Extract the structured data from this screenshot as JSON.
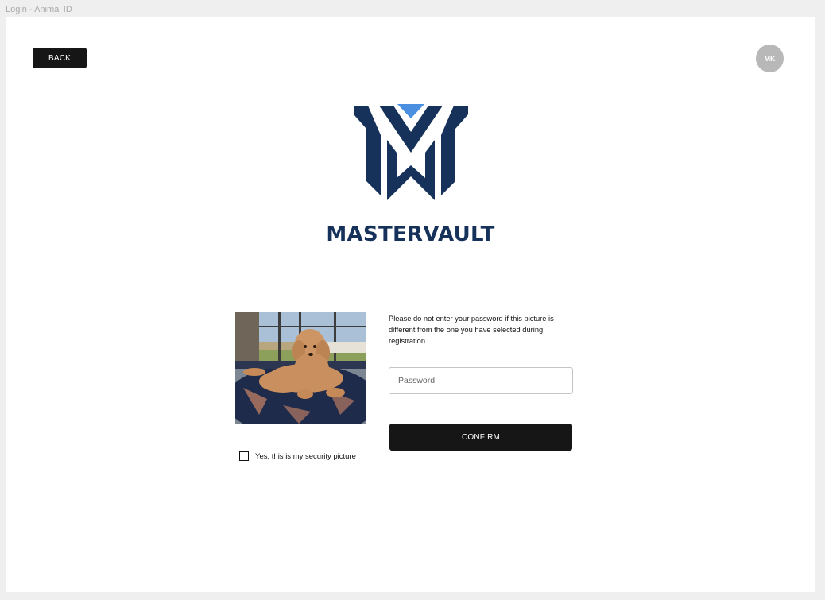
{
  "window": {
    "frame_title": "Login - Animal ID"
  },
  "header": {
    "back_label": "BACK",
    "avatar_initials": "MK"
  },
  "brand": {
    "name": "MASTERVAULT",
    "logo_icon": "mastervault-m-logo-icon",
    "colors": {
      "navy": "#16325a",
      "accent_blue": "#4a8fe0"
    }
  },
  "security": {
    "photo_icon": "dog-photo",
    "checkbox_label": "Yes, this is my security picture",
    "checkbox_checked": false,
    "warning_text": "Please do not enter your password if this picture is different from the one you have selected during registration."
  },
  "form": {
    "password_placeholder": "Password",
    "password_value": "",
    "confirm_label": "CONFIRM"
  },
  "colors": {
    "button_bg": "#161616",
    "avatar_bg": "#b8b8b8",
    "canvas_bg": "#efefef"
  }
}
